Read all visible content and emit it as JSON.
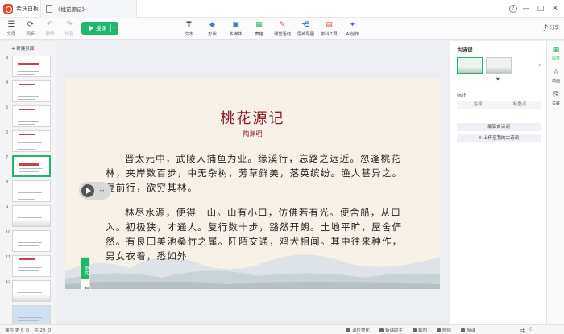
{
  "app": {
    "name": "希沃白板",
    "doc_title": "《桃花源记》"
  },
  "window": {
    "help": "?",
    "minimize": "—",
    "maximize": "□",
    "close": "✕"
  },
  "toolbar": {
    "file": "文件",
    "sync": "同步",
    "undo": "撤销",
    "redo": "恢复",
    "play": "授课",
    "tools": [
      {
        "label": "文本",
        "icon": "text-icon",
        "glyph": "T",
        "color": "#333333"
      },
      {
        "label": "形状",
        "icon": "shape-icon",
        "glyph": "◆",
        "color": "#3a7bd5"
      },
      {
        "label": "多媒体",
        "icon": "media-icon",
        "glyph": "▣",
        "color": "#3a7bd5"
      },
      {
        "label": "表格",
        "icon": "table-icon",
        "glyph": "▦",
        "color": "#1fb86a"
      },
      {
        "label": "课堂活动",
        "icon": "activity-icon",
        "glyph": "✎",
        "color": "#e84c3d"
      },
      {
        "label": "思维导图",
        "icon": "mindmap-icon",
        "glyph": "⋲",
        "color": "#3a7bd5"
      },
      {
        "label": "学科工具",
        "icon": "subject-tools-icon",
        "glyph": "▤",
        "color": "#e84c3d"
      },
      {
        "label": "AI创作",
        "icon": "ai-icon",
        "glyph": "✦",
        "color": "#6c5ce7"
      }
    ],
    "share": "分享"
  },
  "leftpanel": {
    "new_page": "+ 新建页面",
    "thumbs": [
      "3",
      "4",
      "5",
      "6",
      "7",
      "8",
      "9",
      "10",
      "11",
      "12",
      ""
    ]
  },
  "slide": {
    "title": "桃花源记",
    "author": "陶渊明",
    "para1": "晋太元中，武陵人捕鱼为业。缘溪行，忘路之远近。忽逢桃花林，夹岸数百步，中无杂树，芳草鲜美，落英缤纷。渔人甚异之。复前行，欲穷其林。",
    "para2": "林尽水源，便得一山。山有小口，仿佛若有光。便舍船，从口入。初极狭，才通人。复行数十步，豁然开朗。土地平旷，屋舍俨然。有良田美池桑竹之属。阡陌交通，鸡犬相闻。其中往来种作，男女衣着，悉如外",
    "side_tab_1": "原文",
    "side_tab_2": "翻译"
  },
  "rightpanel": {
    "title": "古诗词",
    "more": "›",
    "label": "标注",
    "toggle_1": "注释",
    "toggle_2": "标重点",
    "edit_button": "编辑古诗词",
    "upload_button": "上传至我的古诗词"
  },
  "rail": {
    "item1": "属性",
    "item2": "动画",
    "item3": "关联"
  },
  "status": {
    "page": "课件 第 6 页，共 29 页",
    "beautify": "课件美化",
    "assistant": "备课助手",
    "screenshot": "截图",
    "delete": "删除",
    "teach": "授课",
    "ime": "中"
  }
}
